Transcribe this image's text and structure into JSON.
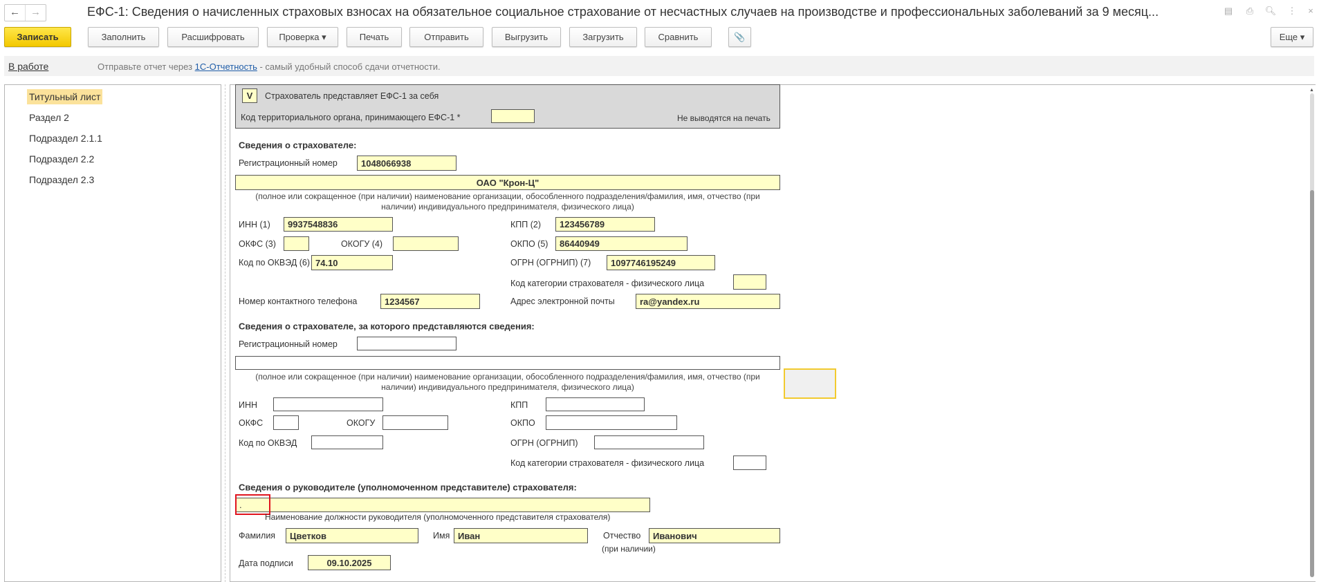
{
  "window": {
    "title": "ЕФС-1: Сведения о начисленных страховых взносах на обязательное социальное страхование от несчастных случаев на производстве и профессиональных заболеваний за 9 месяц...",
    "back": "←",
    "forward": "→",
    "icons": [
      "save-icon",
      "print-icon",
      "preview-icon",
      "more-icon",
      "close-icon"
    ],
    "icon_glyphs": [
      "▤",
      "⎙",
      "🔍︎",
      "⋮",
      "×"
    ]
  },
  "toolbar": {
    "save": "Записать",
    "fill": "Заполнить",
    "decode": "Расшифровать",
    "check": "Проверка ▾",
    "print": "Печать",
    "send": "Отправить",
    "export": "Выгрузить",
    "import": "Загрузить",
    "compare": "Сравнить",
    "attach": "📎",
    "more": "Еще ▾"
  },
  "status": {
    "state": "В работе",
    "msg_pre": "Отправьте отчет через ",
    "msg_link": "1С-Отчетность",
    "msg_post": " - самый удобный способ сдачи отчетности."
  },
  "sidebar": {
    "items": [
      "Титульный лист",
      "Раздел 2",
      "Подраздел 2.1.1",
      "Подраздел 2.2",
      "Подраздел 2.3"
    ]
  },
  "form": {
    "self_flag": "V",
    "self_label": "Страхователь представляет ЕФС-1 за себя",
    "terr_label": "Код территориального органа, принимающего ЕФС-1 *",
    "terr_value": "",
    "noprint": "Не выводятся на печать",
    "s1": {
      "header": "Сведения о страхователе:",
      "reg_label": "Регистрационный номер",
      "reg": "1048066938",
      "name": "ОАО \"Крон-Ц\"",
      "caption1": "(полное или сокращенное (при наличии) наименование организации, обособленного подразделения/фамилия, имя, отчество (при",
      "caption2": "наличии) индивидуального предпринимателя, физического лица)",
      "inn_label": "ИНН (1)",
      "inn": "9937548836",
      "kpp_label": "КПП (2)",
      "kpp": "123456789",
      "okfs_label": "ОКФС (3)",
      "okfs": "",
      "okogu_label": "ОКОГУ (4)",
      "okogu": "",
      "okpo_label": "ОКПО (5)",
      "okpo": "86440949",
      "okved_label": "Код по ОКВЭД (6)",
      "okved": "74.10",
      "ogrn_label": "ОГРН (ОГРНИП) (7)",
      "ogrn": "1097746195249",
      "cat_label": "Код категории страхователя - физического лица",
      "cat": "",
      "phone_label": "Номер контактного телефона",
      "phone": "1234567",
      "email_label": "Адрес электронной почты",
      "email": "ra@yandex.ru"
    },
    "s2": {
      "header": "Сведения о страхователе, за которого представляются сведения:",
      "reg_label": "Регистрационный номер",
      "caption1": "(полное или сокращенное (при наличии) наименование организации, обособленного подразделения/фамилия, имя, отчество (при",
      "caption2": "наличии) индивидуального предпринимателя, физического лица)",
      "inn_label": "ИНН",
      "kpp_label": "КПП",
      "okfs_label": "ОКФС",
      "okogu_label": "ОКОГУ",
      "okpo_label": "ОКПО",
      "okved_label": "Код по ОКВЭД",
      "ogrn_label": "ОГРН (ОГРНИП)",
      "cat_label": "Код категории страхователя - физического лица"
    },
    "s3": {
      "header": "Сведения о руководителе (уполномоченном представителе) страхователя:",
      "position": ".",
      "position_caption": "Наименование должности руководителя (уполномоченного представителя страхователя)",
      "last_label": "Фамилия",
      "last": "Цветков",
      "first_label": "Имя",
      "first": "Иван",
      "middle_label": "Отчество",
      "middle": "Иванович",
      "middle_note": "(при наличии)",
      "date_label": "Дата подписи",
      "date": "09.10.2025"
    }
  },
  "colors": {
    "field": "#ffffc8",
    "highlight": "#fbe29b",
    "primary": "#f5cc00",
    "error": "#e0141e"
  }
}
